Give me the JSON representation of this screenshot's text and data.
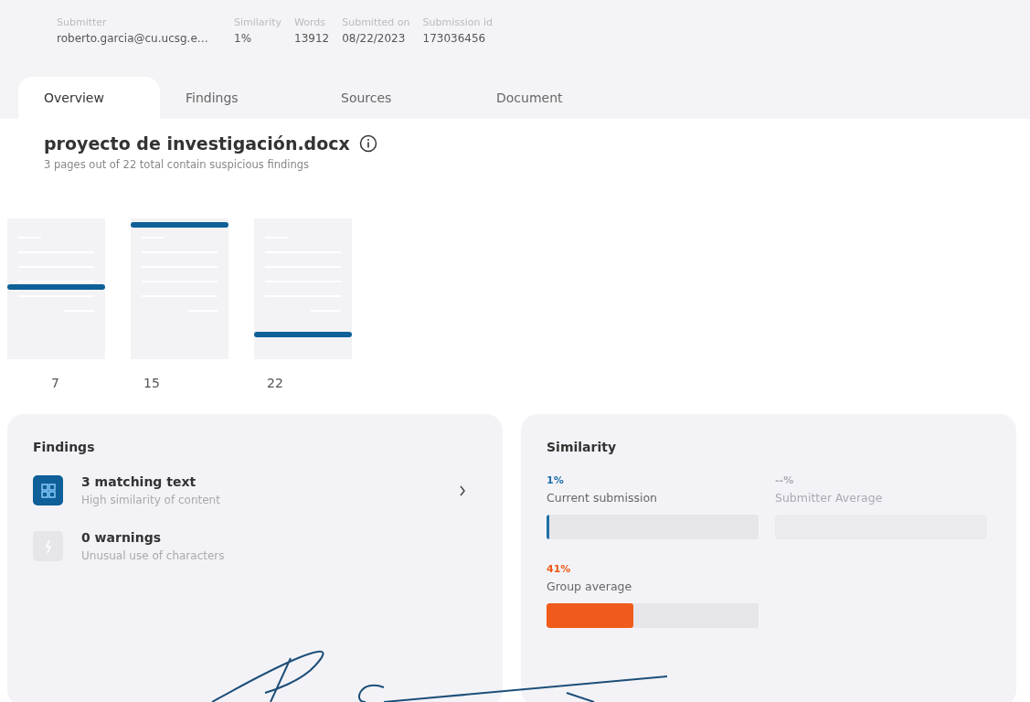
{
  "meta": [
    {
      "label": "Submitter",
      "value": "roberto.garcia@cu.ucsg.e…"
    },
    {
      "label": "Similarity",
      "value": "1%"
    },
    {
      "label": "Words",
      "value": "13912"
    },
    {
      "label": "Submitted on",
      "value": "08/22/2023"
    },
    {
      "label": "Submission id",
      "value": "173036456"
    }
  ],
  "tabs": [
    {
      "label": "Overview",
      "selected": true
    },
    {
      "label": "Findings",
      "selected": false
    },
    {
      "label": "Sources",
      "selected": false
    },
    {
      "label": "Document",
      "selected": false
    }
  ],
  "document": {
    "title": "proyecto de investigación.docx",
    "subtitle": "3 pages out of 22 total contain suspicious findings"
  },
  "pages": [
    {
      "label": "7"
    },
    {
      "label": "15"
    },
    {
      "label": "22"
    }
  ],
  "findings": {
    "title": "Findings",
    "items": [
      {
        "kind": "matching",
        "title": "3 matching text",
        "subtitle": "High similarity of content",
        "disabled": false
      },
      {
        "kind": "warnings",
        "title": "0 warnings",
        "subtitle": "Unusual use of characters",
        "disabled": true
      }
    ]
  },
  "similarity": {
    "title": "Similarity",
    "metrics": [
      {
        "value": "1%",
        "label": "Current submission",
        "level": 0.01,
        "color": "#1f6fa8",
        "disabled": false
      },
      {
        "value": "--%",
        "label": "Submitter Average",
        "disabled": true
      },
      {
        "value": "41%",
        "label": "Group average",
        "level": 0.41,
        "color": "#f05a1a",
        "disabled": false
      }
    ]
  }
}
